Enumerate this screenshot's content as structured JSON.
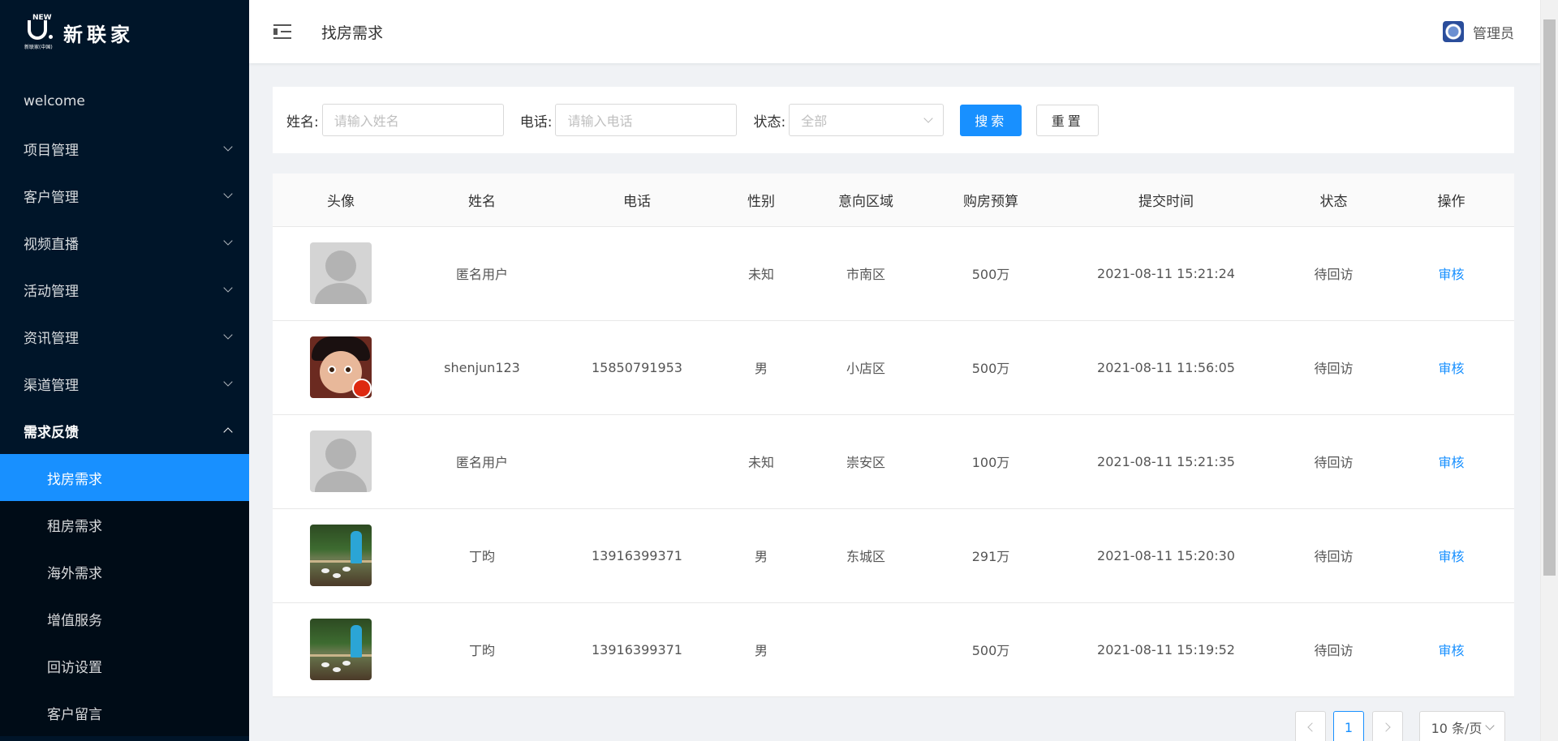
{
  "logo": {
    "text": "新联家",
    "mark_top": "NEW",
    "mark_sub": "新联家(中国)"
  },
  "sidebar": {
    "items": [
      {
        "label": "welcome",
        "has_children": false
      },
      {
        "label": "项目管理",
        "has_children": true
      },
      {
        "label": "客户管理",
        "has_children": true
      },
      {
        "label": "视频直播",
        "has_children": true
      },
      {
        "label": "活动管理",
        "has_children": true
      },
      {
        "label": "资讯管理",
        "has_children": true
      },
      {
        "label": "渠道管理",
        "has_children": true
      },
      {
        "label": "需求反馈",
        "has_children": true,
        "expanded": true
      }
    ],
    "submenu": [
      {
        "label": "找房需求",
        "active": true
      },
      {
        "label": "租房需求"
      },
      {
        "label": "海外需求"
      },
      {
        "label": "增值服务"
      },
      {
        "label": "回访设置"
      },
      {
        "label": "客户留言"
      }
    ]
  },
  "header": {
    "title": "找房需求",
    "user": "管理员",
    "fold_icon": "menu-fold-icon"
  },
  "filter": {
    "name_label": "姓名:",
    "name_placeholder": "请输入姓名",
    "phone_label": "电话:",
    "phone_placeholder": "请输入电话",
    "status_label": "状态:",
    "status_value": "全部",
    "search_btn": "搜索",
    "reset_btn": "重置"
  },
  "table": {
    "columns": [
      "头像",
      "姓名",
      "电话",
      "性别",
      "意向区域",
      "购房预算",
      "提交时间",
      "状态",
      "操作"
    ],
    "rows": [
      {
        "avatar": "default",
        "name": "匿名用户",
        "phone": "",
        "gender": "未知",
        "area": "市南区",
        "budget": "500万",
        "time": "2021-08-11 15:21:24",
        "status": "待回访",
        "action": "审核"
      },
      {
        "avatar": "cartoon",
        "name": "shenjun123",
        "phone": "15850791953",
        "gender": "男",
        "area": "小店区",
        "budget": "500万",
        "time": "2021-08-11 11:56:05",
        "status": "待回访",
        "action": "审核"
      },
      {
        "avatar": "default",
        "name": "匿名用户",
        "phone": "",
        "gender": "未知",
        "area": "崇安区",
        "budget": "100万",
        "time": "2021-08-11 15:21:35",
        "status": "待回访",
        "action": "审核"
      },
      {
        "avatar": "photo",
        "name": "丁昀",
        "phone": "13916399371",
        "gender": "男",
        "area": "东城区",
        "budget": "291万",
        "time": "2021-08-11 15:20:30",
        "status": "待回访",
        "action": "审核"
      },
      {
        "avatar": "photo",
        "name": "丁昀",
        "phone": "13916399371",
        "gender": "男",
        "area": "",
        "budget": "500万",
        "time": "2021-08-11 15:19:52",
        "status": "待回访",
        "action": "审核"
      }
    ]
  },
  "pagination": {
    "current": "1",
    "page_size": "10 条/页"
  },
  "colors": {
    "sidebar_bg": "#001529",
    "accent": "#1890ff",
    "link": "#1890ff"
  }
}
